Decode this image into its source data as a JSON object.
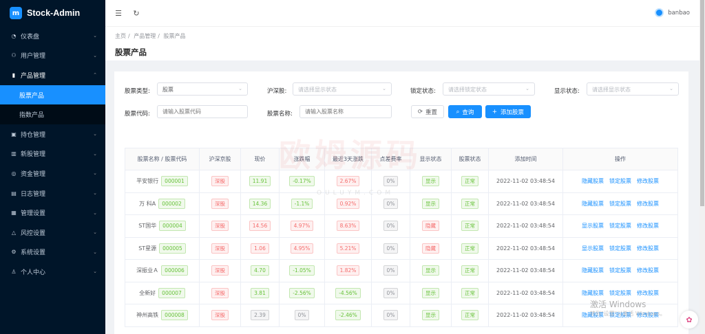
{
  "app": {
    "title": "Stock-Admin",
    "logo_letter": "m",
    "user": "banbao"
  },
  "sidebar": {
    "items": [
      {
        "label": "仪表盘",
        "icon": "dashboard-icon"
      },
      {
        "label": "用户管理",
        "icon": "users-icon"
      },
      {
        "label": "产品管理",
        "icon": "chart-icon",
        "open": true,
        "children": [
          "股票产品",
          "指数产品"
        ]
      },
      {
        "label": "持仓管理",
        "icon": "position-icon"
      },
      {
        "label": "新股管理",
        "icon": "ipo-icon"
      },
      {
        "label": "资金管理",
        "icon": "funds-icon"
      },
      {
        "label": "日志管理",
        "icon": "log-icon"
      },
      {
        "label": "管理设置",
        "icon": "settings-icon"
      },
      {
        "label": "风控设置",
        "icon": "risk-icon"
      },
      {
        "label": "系统设置",
        "icon": "system-icon"
      },
      {
        "label": "个人中心",
        "icon": "user-icon"
      }
    ]
  },
  "breadcrumb": [
    "主页",
    "产品管理",
    "股票产品"
  ],
  "breadcrumb_sep": "/",
  "page_title": "股票产品",
  "filters": {
    "stock_type_label": "股票类型:",
    "stock_type_value": "股票",
    "exchange_label": "沪深股:",
    "exchange_placeholder": "请选择显示状态",
    "lock_label": "锁定状态:",
    "lock_placeholder": "请选择锁定状态",
    "display_label": "显示状态:",
    "display_placeholder": "请选择显示状态",
    "code_label": "股票代码:",
    "code_placeholder": "请输入股票代码",
    "name_label": "股票名称:",
    "name_placeholder": "请输入股票名称",
    "reset": "重置",
    "query": "查询",
    "add": "添加股票"
  },
  "table": {
    "headers": [
      "股票名称 / 股票代码",
      "沪深京股",
      "现价",
      "涨跌幅",
      "最近3天涨跌",
      "点差费率",
      "显示状态",
      "股票状态",
      "添加时间",
      "操作"
    ],
    "rows": [
      {
        "name": "平安银行",
        "code": "000001",
        "market": "深股",
        "price": "11.91",
        "change": "-0.17%",
        "change_color": "green",
        "three_day": "2.67%",
        "three_color": "red",
        "spread": "0%",
        "display": "显示",
        "display_color": "green",
        "status": "正常",
        "time": "2022-11-02 03:48:54",
        "op1": "隐藏股票",
        "op2": "锁定股票",
        "op3": "修改股票"
      },
      {
        "name": "万 科A",
        "code": "000002",
        "market": "深股",
        "price": "14.36",
        "change": "-1.1%",
        "change_color": "green",
        "three_day": "0.92%",
        "three_color": "red",
        "spread": "0%",
        "display": "显示",
        "display_color": "green",
        "status": "正常",
        "time": "2022-11-02 03:48:54",
        "op1": "隐藏股票",
        "op2": "锁定股票",
        "op3": "修改股票"
      },
      {
        "name": "ST国华",
        "code": "000004",
        "market": "深股",
        "price": "14.56",
        "change": "4.97%",
        "change_color": "red",
        "three_day": "8.63%",
        "three_color": "red",
        "spread": "0%",
        "display": "隐藏",
        "display_color": "red",
        "status": "正常",
        "time": "2022-11-02 03:48:54",
        "op1": "显示股票",
        "op2": "锁定股票",
        "op3": "修改股票"
      },
      {
        "name": "ST星源",
        "code": "000005",
        "market": "深股",
        "price": "1.06",
        "change": "4.95%",
        "change_color": "red",
        "three_day": "5.21%",
        "three_color": "red",
        "spread": "0%",
        "display": "隐藏",
        "display_color": "red",
        "status": "正常",
        "time": "2022-11-02 03:48:54",
        "op1": "显示股票",
        "op2": "锁定股票",
        "op3": "修改股票"
      },
      {
        "name": "深振业Ａ",
        "code": "000006",
        "market": "深股",
        "price": "4.70",
        "change": "-1.05%",
        "change_color": "green",
        "three_day": "1.82%",
        "three_color": "red",
        "spread": "0%",
        "display": "显示",
        "display_color": "green",
        "status": "正常",
        "time": "2022-11-02 03:48:54",
        "op1": "隐藏股票",
        "op2": "锁定股票",
        "op3": "修改股票"
      },
      {
        "name": "全新好",
        "code": "000007",
        "market": "深股",
        "price": "3.81",
        "change": "-2.56%",
        "change_color": "green",
        "three_day": "-4.56%",
        "three_color": "green",
        "spread": "0%",
        "display": "显示",
        "display_color": "green",
        "status": "正常",
        "time": "2022-11-02 03:48:54",
        "op1": "隐藏股票",
        "op2": "锁定股票",
        "op3": "修改股票"
      },
      {
        "name": "神州高铁",
        "code": "000008",
        "market": "深股",
        "price": "2.39",
        "change": "0%",
        "change_color": "grey",
        "three_day": "-2.46%",
        "three_color": "green",
        "spread": "0%",
        "display": "显示",
        "display_color": "green",
        "status": "正常",
        "time": "2022-11-02 03:48:54",
        "op1": "隐藏股票",
        "op2": "锁定股票",
        "op3": "修改股票"
      }
    ]
  },
  "watermark": {
    "main": "欧姆源码",
    "sub": "OULUYM.COM"
  },
  "windows_notice": {
    "line1": "激活 Windows",
    "line2": "转到\"设置\"以激活 Windows。"
  }
}
